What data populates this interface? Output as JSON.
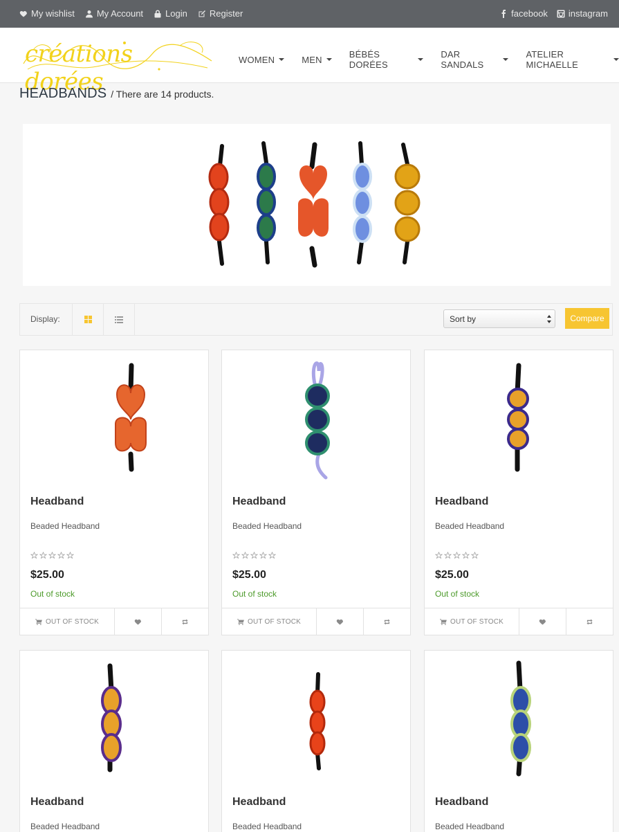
{
  "topbar": {
    "wishlist": "My wishlist",
    "account": "My Account",
    "login": "Login",
    "register": "Register",
    "facebook": "facebook",
    "instagram": "instagram"
  },
  "brand": {
    "logo_text": "créations dorées",
    "logo_color": "#f2d21b"
  },
  "nav": {
    "items": [
      "WOMEN",
      "MEN",
      "BÉBÉS DORÉES",
      "DAR SANDALS",
      "ATELIER MICHAELLE"
    ]
  },
  "category": {
    "title": "HEADBANDS",
    "count_text": "/ There are 14 products."
  },
  "toolbar": {
    "display_label": "Display:",
    "sort_label": "Sort by",
    "compare_label": "Compare",
    "accent": "#f7c531"
  },
  "products": [
    {
      "name": "Headband",
      "desc": "Beaded Headband",
      "price": "$25.00",
      "stock": "Out of stock",
      "cart_label": "OUT OF STOCK",
      "rating": 0
    },
    {
      "name": "Headband",
      "desc": "Beaded Headband",
      "price": "$25.00",
      "stock": "Out of stock",
      "cart_label": "OUT OF STOCK",
      "rating": 0
    },
    {
      "name": "Headband",
      "desc": "Beaded Headband",
      "price": "$25.00",
      "stock": "Out of stock",
      "cart_label": "OUT OF STOCK",
      "rating": 0
    },
    {
      "name": "Headband",
      "desc": "Beaded Headband"
    },
    {
      "name": "Headband",
      "desc": "Beaded Headband"
    },
    {
      "name": "Headband",
      "desc": "Beaded Headband"
    }
  ]
}
